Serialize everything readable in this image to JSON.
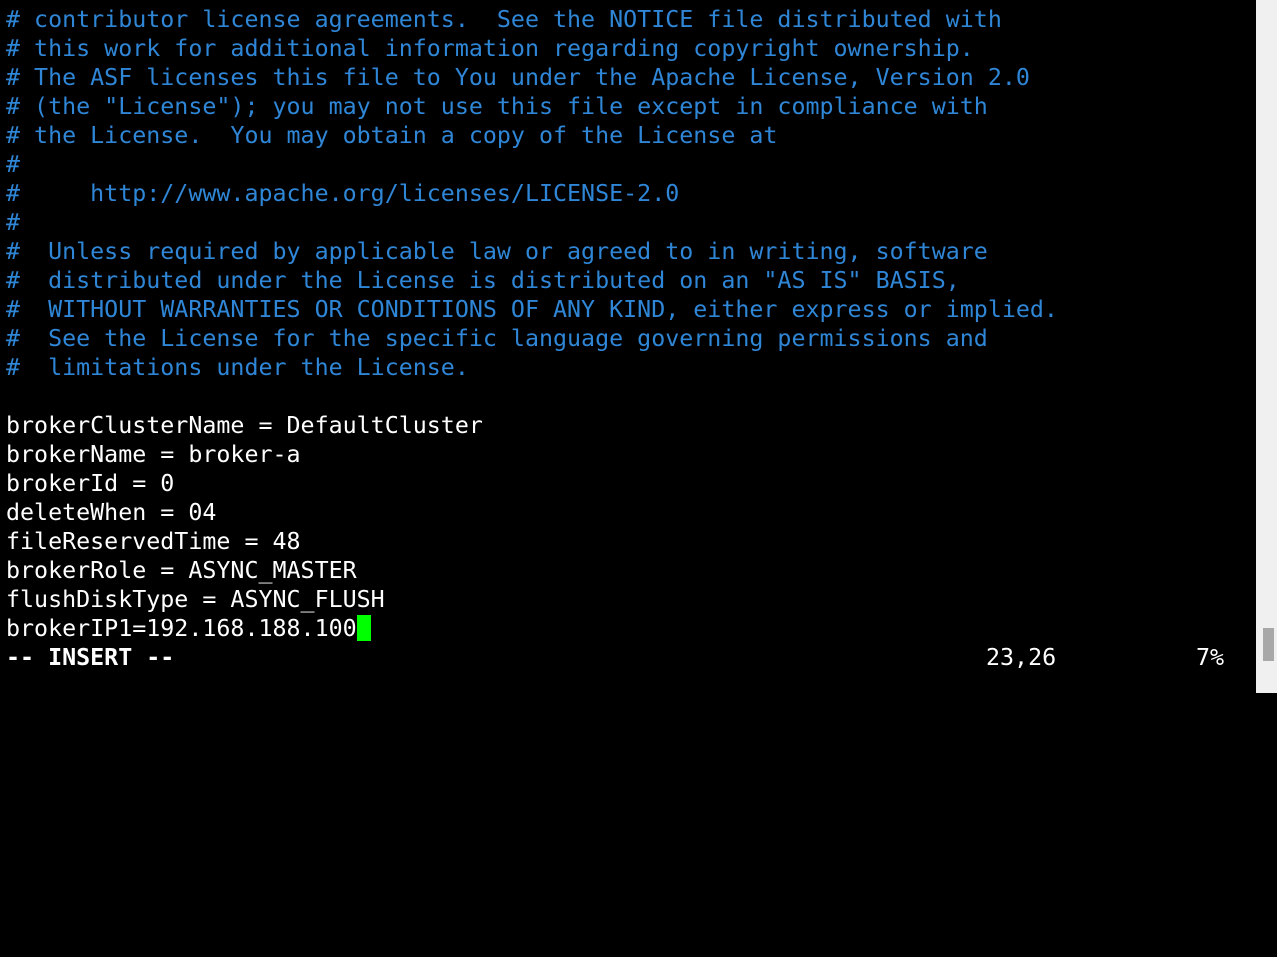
{
  "editor": {
    "comment_lines": [
      "# contributor license agreements.  See the NOTICE file distributed with",
      "# this work for additional information regarding copyright ownership.",
      "# The ASF licenses this file to You under the Apache License, Version 2.0",
      "# (the \"License\"); you may not use this file except in compliance with",
      "# the License.  You may obtain a copy of the License at",
      "#",
      "#     http://www.apache.org/licenses/LICENSE-2.0",
      "#",
      "#  Unless required by applicable law or agreed to in writing, software",
      "#  distributed under the License is distributed on an \"AS IS\" BASIS,",
      "#  WITHOUT WARRANTIES OR CONDITIONS OF ANY KIND, either express or implied.",
      "#  See the License for the specific language governing permissions and",
      "#  limitations under the License."
    ],
    "blank_line": "",
    "config_lines": [
      "brokerClusterName = DefaultCluster",
      "brokerName = broker-a",
      "brokerId = 0",
      "deleteWhen = 04",
      "fileReservedTime = 48",
      "brokerRole = ASYNC_MASTER",
      "flushDiskType = ASYNC_FLUSH",
      "brokerIP1=192.168.188.100"
    ]
  },
  "status_bar": {
    "mode": "-- INSERT --",
    "cursor_position": "23,26",
    "scroll_percent": "7%"
  },
  "colors": {
    "background": "#000000",
    "comment": "#2f86d6",
    "text": "#ffffff",
    "cursor": "#00ff00"
  }
}
